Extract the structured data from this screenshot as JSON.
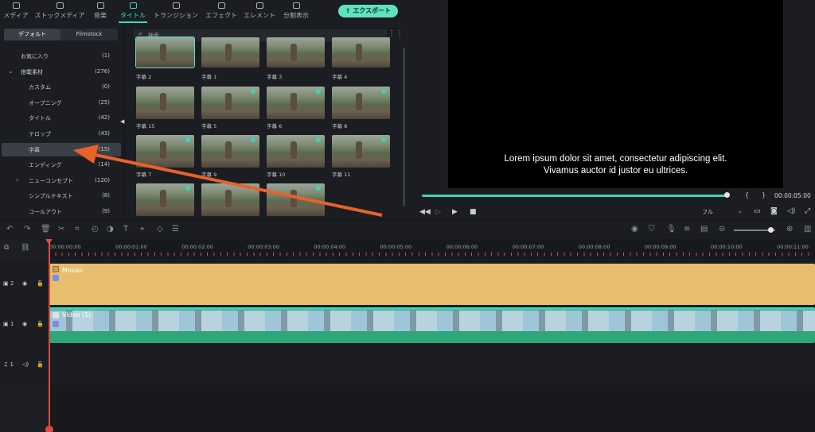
{
  "toolbar": {
    "items": [
      {
        "label": "メディア",
        "icon": "media-icon"
      },
      {
        "label": "ストックメディア",
        "icon": "stock-media-icon"
      },
      {
        "label": "音楽",
        "icon": "music-icon"
      },
      {
        "label": "タイトル",
        "icon": "title-icon",
        "active": true
      },
      {
        "label": "トランジション",
        "icon": "transition-icon"
      },
      {
        "label": "エフェクト",
        "icon": "effect-icon"
      },
      {
        "label": "エレメント",
        "icon": "element-icon"
      },
      {
        "label": "分割表示",
        "icon": "split-screen-icon"
      }
    ],
    "export_label": "エクスポート",
    "accent": "#3fd6b3"
  },
  "library": {
    "tabs": [
      "デフォルト",
      "Filmstock"
    ],
    "categories": [
      {
        "label": "お気に入り",
        "count": "(1)"
      },
      {
        "label": "搭載素材",
        "count": "(276)",
        "expanded": true
      },
      {
        "label": "カスタム",
        "count": "(0)"
      },
      {
        "label": "オープニング",
        "count": "(25)"
      },
      {
        "label": "タイトル",
        "count": "(42)"
      },
      {
        "label": "テロップ",
        "count": "(43)"
      },
      {
        "label": "字幕",
        "count": "(15)",
        "selected": true
      },
      {
        "label": "エンディング",
        "count": "(14)"
      },
      {
        "label": "ニューコンセプト",
        "count": "(120)",
        "collapsed": true
      },
      {
        "label": "シンプルテキスト",
        "count": "(8)"
      },
      {
        "label": "コールアウト",
        "count": "(9)"
      }
    ]
  },
  "grid": {
    "search_placeholder": "検索",
    "items": [
      {
        "caption": "字幕 2",
        "selected": true
      },
      {
        "caption": "字幕 1"
      },
      {
        "caption": "字幕 3"
      },
      {
        "caption": "字幕 4"
      },
      {
        "caption": "字幕 15"
      },
      {
        "caption": "字幕 5",
        "download": true
      },
      {
        "caption": "字幕 6",
        "download": true
      },
      {
        "caption": "字幕 8",
        "download": true
      },
      {
        "caption": "字幕 7",
        "download": true
      },
      {
        "caption": "字幕 9",
        "download": true
      },
      {
        "caption": "字幕 10",
        "download": true
      },
      {
        "caption": "字幕 11",
        "download": true
      },
      {
        "caption": "",
        "download": true
      },
      {
        "caption": "",
        "download": true
      },
      {
        "caption": "",
        "download": true
      }
    ]
  },
  "preview": {
    "caption_line1": "Lorem ipsum dolor sit amet, consectetur adipiscing elit.",
    "caption_line2": "Vivamus auctor id justor eu ultrices.",
    "timecode": "00:00:05:00",
    "progress": 1.0,
    "quality": "フル",
    "mark_in": "{",
    "mark_out": "}"
  },
  "timeline": {
    "ruler": [
      "00:00:00:00",
      "00:00:01:00",
      "00:00:02:00",
      "00:00:03:00",
      "00:00:04:00",
      "00:00:05:00",
      "00:00:06:00",
      "00:00:07:00",
      "00:00:08:00",
      "00:00:09:00",
      "00:00:10:00",
      "00:00:11:00"
    ],
    "tracks": [
      {
        "number": "2",
        "type": "video",
        "clip": "Mosaic"
      },
      {
        "number": "1",
        "type": "video",
        "clip": "Video (1)"
      },
      {
        "number": "1",
        "type": "audio",
        "clip": ""
      }
    ],
    "zoom_level": 0.88
  }
}
